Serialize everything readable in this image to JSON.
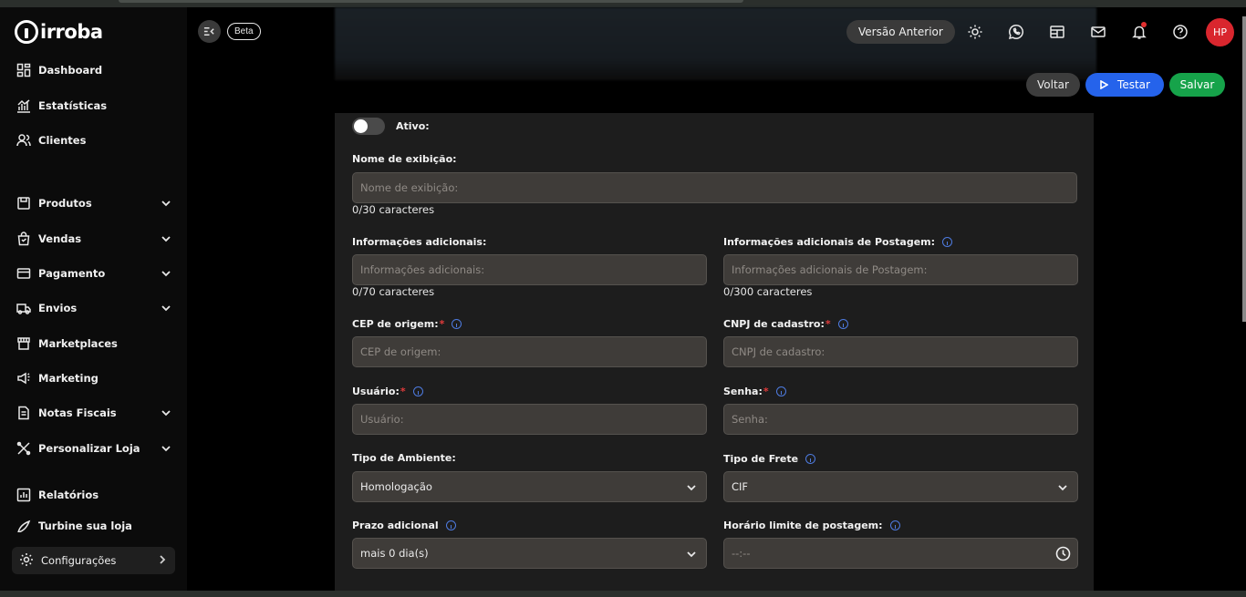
{
  "brand": {
    "name": "irroba"
  },
  "sidebar": {
    "items": [
      {
        "label": "Dashboard",
        "icon": "dashboard-icon"
      },
      {
        "label": "Estatísticas",
        "icon": "stats-icon"
      },
      {
        "label": "Clientes",
        "icon": "users-icon"
      },
      {
        "label": "Produtos",
        "icon": "box-icon",
        "expandable": true
      },
      {
        "label": "Vendas",
        "icon": "bag-icon",
        "expandable": true
      },
      {
        "label": "Pagamento",
        "icon": "card-icon",
        "expandable": true
      },
      {
        "label": "Envios",
        "icon": "truck-icon",
        "expandable": true
      },
      {
        "label": "Marketplaces",
        "icon": "store-icon"
      },
      {
        "label": "Marketing",
        "icon": "megaphone-icon"
      },
      {
        "label": "Notas Fiscais",
        "icon": "document-icon",
        "expandable": true
      },
      {
        "label": "Personalizar Loja",
        "icon": "tools-icon",
        "expandable": true
      },
      {
        "label": "Relatórios",
        "icon": "report-icon"
      },
      {
        "label": "Turbine sua loja",
        "icon": "rocket-icon"
      }
    ],
    "config_label": "Configurações"
  },
  "header": {
    "beta": "Beta",
    "versao": "Versão Anterior",
    "avatar": "HP"
  },
  "actions": {
    "voltar": "Voltar",
    "testar": "Testar",
    "salvar": "Salvar"
  },
  "form": {
    "ativo_label": "Ativo:",
    "nome": {
      "label": "Nome de exibição:",
      "placeholder": "Nome de exibição:",
      "count": "0/30 caracteres"
    },
    "info_adic": {
      "label": "Informações adicionais:",
      "placeholder": "Informações adicionais:",
      "count": "0/70 caracteres"
    },
    "info_post": {
      "label": "Informações adicionais de Postagem:",
      "placeholder": "Informações adicionais de Postagem:",
      "count": "0/300 caracteres"
    },
    "cep": {
      "label": "CEP de origem:",
      "placeholder": "CEP de origem:"
    },
    "cnpj": {
      "label": "CNPJ de cadastro:",
      "placeholder": "CNPJ de cadastro:"
    },
    "usuario": {
      "label": "Usuário:",
      "placeholder": "Usuário:"
    },
    "senha": {
      "label": "Senha:",
      "placeholder": "Senha:"
    },
    "ambiente": {
      "label": "Tipo de Ambiente:",
      "value": "Homologação"
    },
    "frete": {
      "label": "Tipo de Frete",
      "value": "CIF"
    },
    "prazo": {
      "label": "Prazo adicional",
      "value": "mais 0 dia(s)"
    },
    "horario": {
      "label": "Horário limite de postagem:",
      "placeholder": "--:--"
    },
    "required_mark": "*"
  }
}
